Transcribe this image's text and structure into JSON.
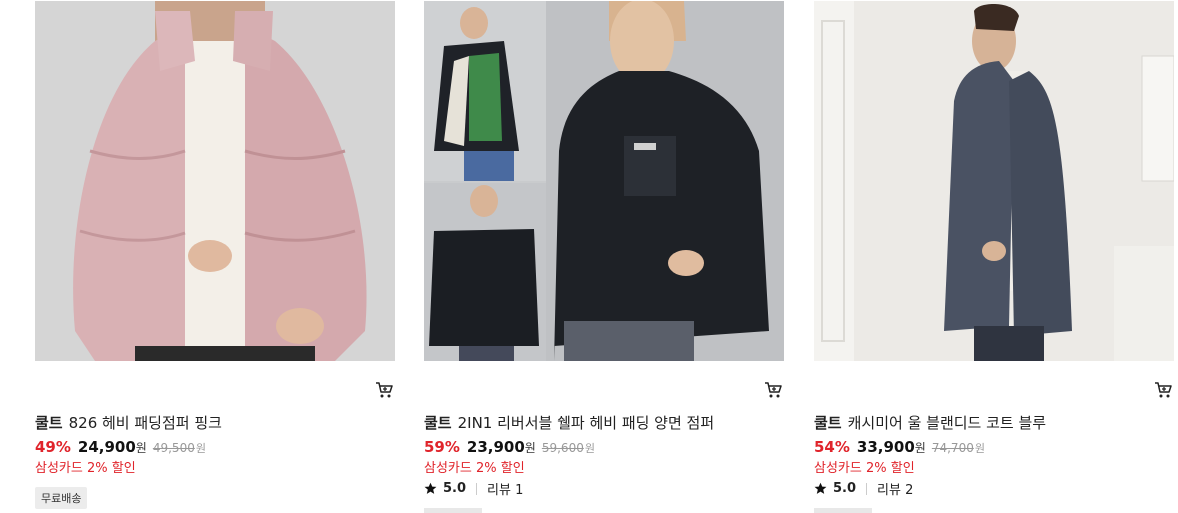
{
  "products": [
    {
      "brand": "쿨트",
      "name": "826 헤비 패딩점퍼 핑크",
      "discount": "49%",
      "sale_price": "24,900",
      "currency": "원",
      "original_price": "49,500",
      "card_promo": "삼성카드 2% 할인",
      "badge": "무료배송",
      "image": "pink-puffer-jacket-photo",
      "colors": {
        "jacket": "#d9b1b4",
        "bg": "#d7d7d7"
      }
    },
    {
      "brand": "쿨트",
      "name": "2IN1 리버서블 쉘파 헤비 패딩 양면 점퍼",
      "discount": "59%",
      "sale_price": "23,900",
      "currency": "원",
      "original_price": "59,600",
      "card_promo": "삼성카드 2% 할인",
      "rating": "5.0",
      "review_label": "리뷰 1",
      "image": "black-sherpa-reversible-jacket-photo",
      "colors": {
        "jacket": "#1c1f24",
        "bg": "#c9cbcd"
      }
    },
    {
      "brand": "쿨트",
      "name": "캐시미어 울 블랜디드 코트 블루",
      "discount": "54%",
      "sale_price": "33,900",
      "currency": "원",
      "original_price": "74,700",
      "card_promo": "삼성카드 2% 할인",
      "rating": "5.0",
      "review_label": "리뷰 2",
      "image": "blue-wool-coat-photo",
      "colors": {
        "coat": "#4a5263",
        "bg": "#eceae6"
      }
    }
  ],
  "icons": {
    "cart": "cart-icon",
    "rating": "star-icon"
  },
  "accent_color": "#e0242b"
}
